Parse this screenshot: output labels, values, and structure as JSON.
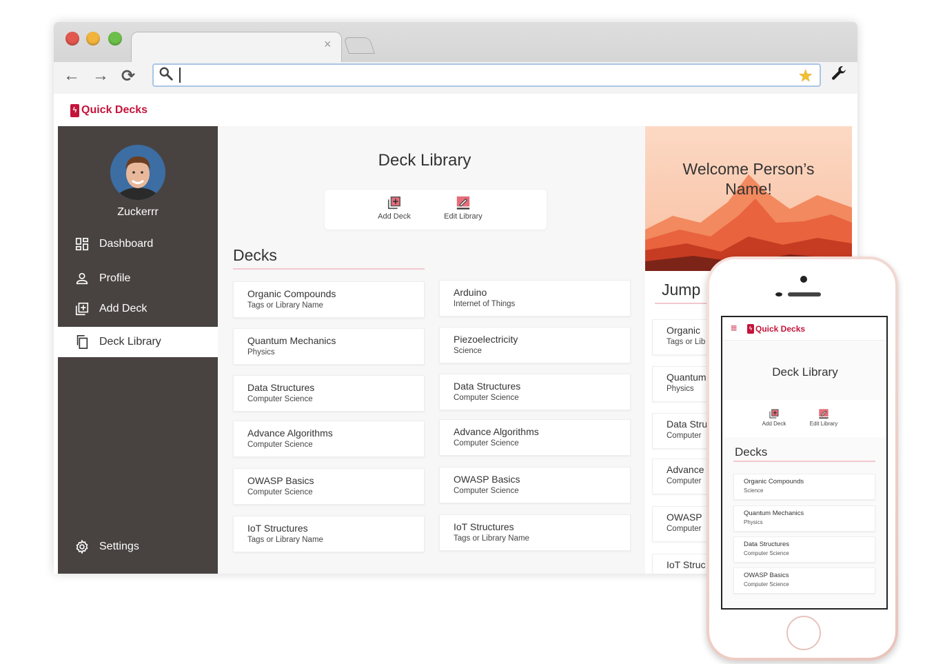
{
  "app": {
    "name": "Quick Decks",
    "logo_glyph": "ϟ",
    "accent": "#c4143a"
  },
  "browser": {
    "tab_close": "×",
    "url_value": "",
    "nav": {
      "back": "←",
      "forward": "→",
      "reload": "⟳"
    },
    "star": "★",
    "wrench": "🔧"
  },
  "sidebar": {
    "username": "Zuckerrr",
    "items": [
      {
        "label": "Dashboard",
        "icon": "dashboard-icon"
      },
      {
        "label": "Profile",
        "icon": "person-icon"
      },
      {
        "label": "Add Deck",
        "icon": "library-add-icon"
      },
      {
        "label": "Deck Library",
        "icon": "copy-icon",
        "active": true
      }
    ],
    "settings": {
      "label": "Settings",
      "icon": "gear-icon"
    }
  },
  "main": {
    "title": "Deck Library",
    "actions": {
      "add_deck": "Add Deck",
      "edit_library": "Edit Library"
    },
    "decks_heading": "Decks",
    "left_column": [
      {
        "title": "Organic Compounds",
        "subtitle": "Tags or Library Name"
      },
      {
        "title": "Quantum Mechanics",
        "subtitle": "Physics"
      },
      {
        "title": "Data Structures",
        "subtitle": "Computer Science"
      },
      {
        "title": "Advance Algorithms",
        "subtitle": "Computer Science"
      },
      {
        "title": "OWASP Basics",
        "subtitle": "Computer Science"
      },
      {
        "title": "IoT Structures",
        "subtitle": "Tags or Library Name"
      }
    ],
    "right_column": [
      {
        "title": "Arduino",
        "subtitle": "Internet of Things"
      },
      {
        "title": "Piezoelectricity",
        "subtitle": "Science"
      },
      {
        "title": "Data Structures",
        "subtitle": "Computer Science"
      },
      {
        "title": "Advance Algorithms",
        "subtitle": "Computer Science"
      },
      {
        "title": "OWASP Basics",
        "subtitle": "Computer Science"
      },
      {
        "title": "IoT Structures",
        "subtitle": "Tags or Library Name"
      }
    ]
  },
  "right_panel": {
    "welcome": "Welcome Person’s Name!",
    "jump_heading": "Jump",
    "items": [
      {
        "title": "Organic",
        "subtitle": "Tags or Lib"
      },
      {
        "title": "Quantum",
        "subtitle": "Physics"
      },
      {
        "title": "Data Stru",
        "subtitle": "Computer"
      },
      {
        "title": "Advance",
        "subtitle": "Computer"
      },
      {
        "title": "OWASP",
        "subtitle": "Computer"
      },
      {
        "title": "IoT Struc",
        "subtitle": ""
      }
    ]
  },
  "phone": {
    "menu_glyph": "≡",
    "title": "Deck Library",
    "actions": {
      "add_deck": "Add Deck",
      "edit_library": "Edit Library"
    },
    "decks_heading": "Decks",
    "decks": [
      {
        "title": "Organic Compounds",
        "subtitle": "Science"
      },
      {
        "title": "Quantum Mechanics",
        "subtitle": "Physics"
      },
      {
        "title": "Data Structures",
        "subtitle": "Computer Science"
      },
      {
        "title": "OWASP Basics",
        "subtitle": "Computer Science"
      }
    ]
  }
}
